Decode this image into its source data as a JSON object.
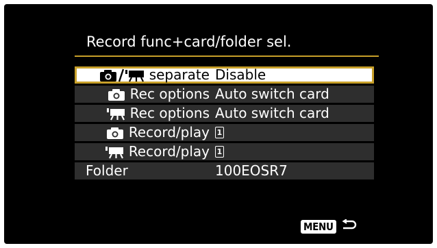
{
  "menu": {
    "title": "Record func+card/folder sel.",
    "items": [
      {
        "label": "separate",
        "value": "Disable",
        "icon": "photo-video-separate-icon",
        "selected": true
      },
      {
        "label": "Rec options",
        "value": "Auto switch card",
        "icon": "camera-icon",
        "selected": false
      },
      {
        "label": "Rec options",
        "value": "Auto switch card",
        "icon": "movie-icon",
        "selected": false
      },
      {
        "label": "Record/play",
        "value": "1",
        "icon": "camera-icon",
        "value_icon": "card-slot-1-icon",
        "selected": false
      },
      {
        "label": "Record/play",
        "value": "1",
        "icon": "movie-icon",
        "value_icon": "card-slot-1-icon",
        "selected": false
      },
      {
        "label": "Folder",
        "value": "100EOSR7",
        "selected": false
      }
    ]
  },
  "footer": {
    "menu_key_label": "MENU",
    "return_icon": "return-arrow-icon"
  },
  "colors": {
    "background": "#000000",
    "accent_gold": "#c8a02a",
    "row_background": "#2e2e2e",
    "selected_background": "#ffffff"
  }
}
